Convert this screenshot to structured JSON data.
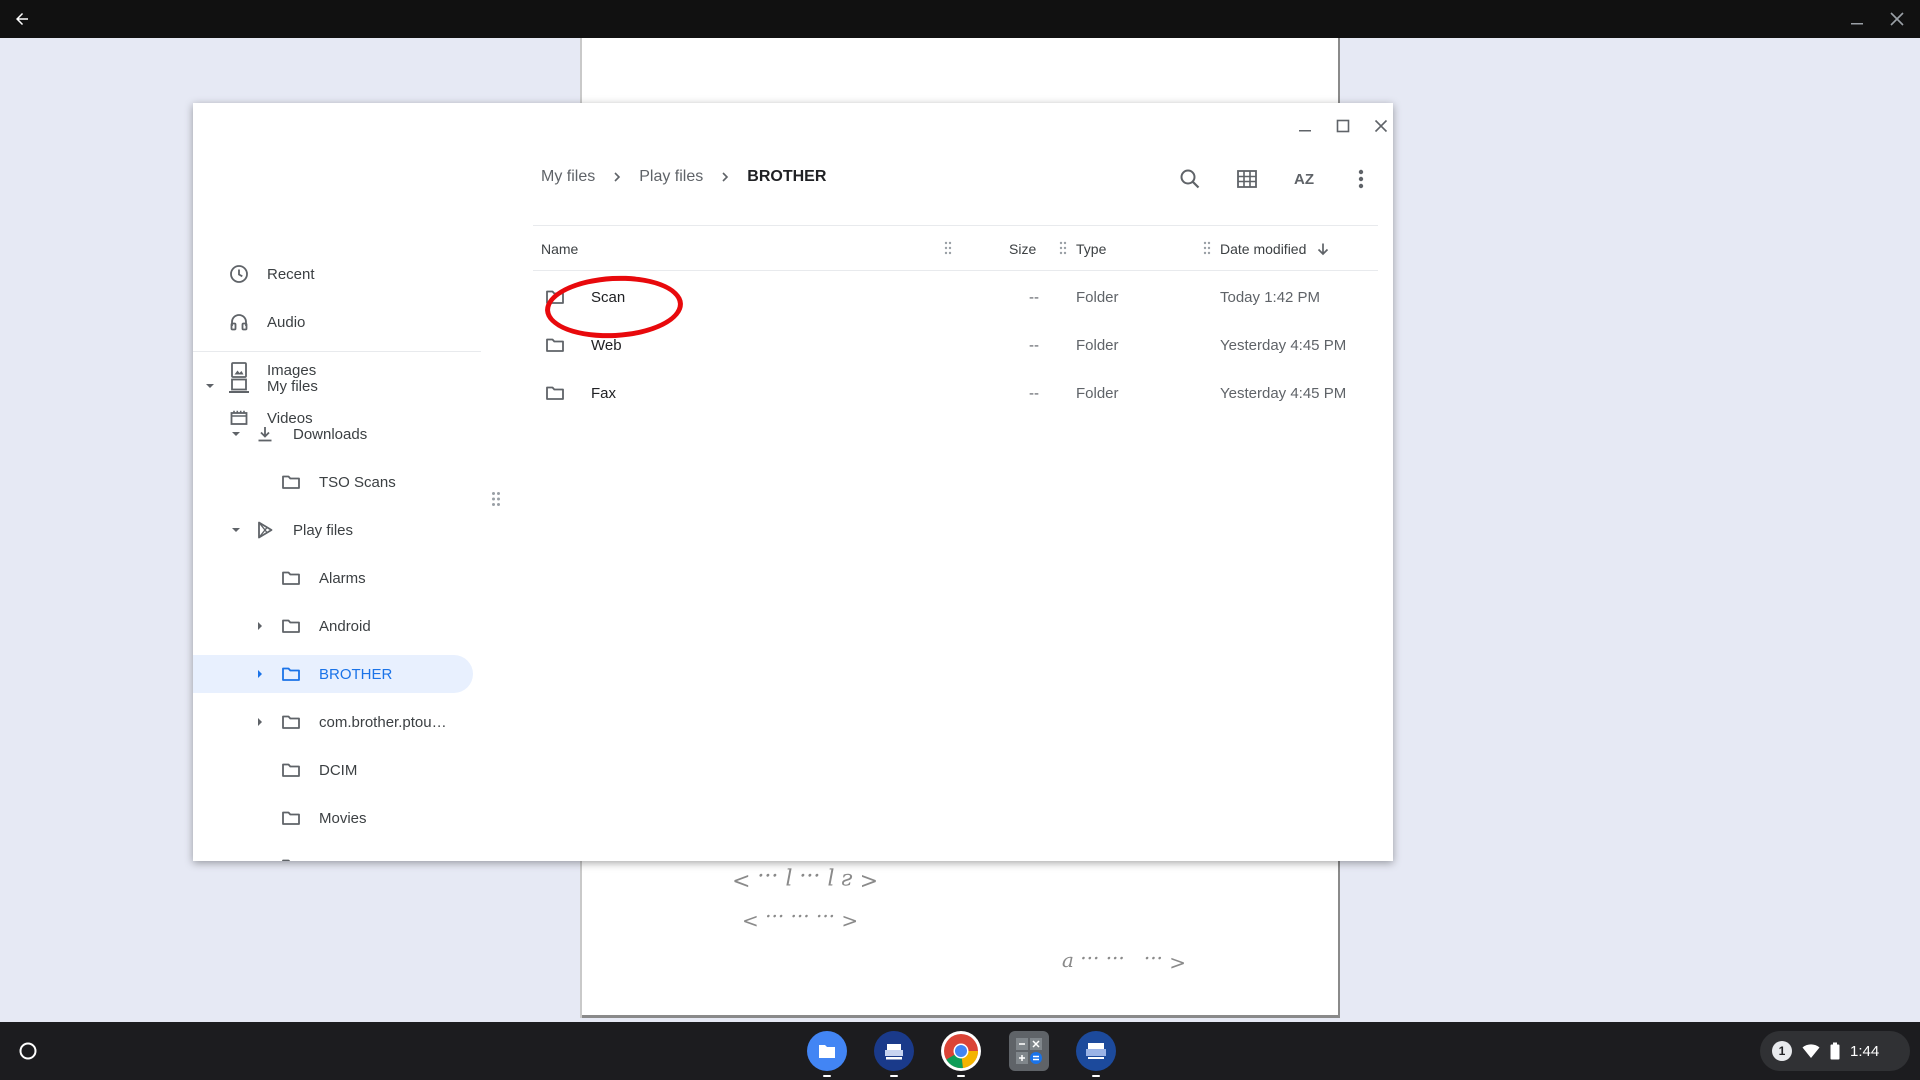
{
  "window": {
    "sidebar": {
      "quick": [
        {
          "label": "Recent",
          "icon": "clock-icon"
        },
        {
          "label": "Audio",
          "icon": "headphones-icon"
        },
        {
          "label": "Images",
          "icon": "image-icon"
        },
        {
          "label": "Videos",
          "icon": "film-icon"
        }
      ],
      "my_files": "My files",
      "downloads": "Downloads",
      "tso_scans": "TSO Scans",
      "play_files": "Play files",
      "play_children": [
        "Alarms",
        "Android",
        "BROTHER",
        "com.brother.ptou…",
        "DCIM",
        "Movies"
      ]
    },
    "breadcrumb": [
      "My files",
      "Play files",
      "BROTHER"
    ],
    "toolbar": {
      "sort_label": "AZ"
    },
    "columns": {
      "name": "Name",
      "size": "Size",
      "type": "Type",
      "date": "Date modified"
    },
    "files": [
      {
        "name": "Scan",
        "size": "--",
        "type": "Folder",
        "date": "Today 1:42 PM"
      },
      {
        "name": "Web",
        "size": "--",
        "type": "Folder",
        "date": "Yesterday 4:45 PM"
      },
      {
        "name": "Fax",
        "size": "--",
        "type": "Folder",
        "date": "Yesterday 4:45 PM"
      }
    ]
  },
  "shelf": {
    "apps": [
      "files-icon",
      "epson-icon",
      "chrome-icon",
      "calculator-icon",
      "brother-icon"
    ],
    "notification_count": "1",
    "time": "1:44"
  },
  "colors": {
    "accent": "#1a73e8",
    "selection_bg": "#e8f0fe",
    "annotation": "#e8090c"
  }
}
